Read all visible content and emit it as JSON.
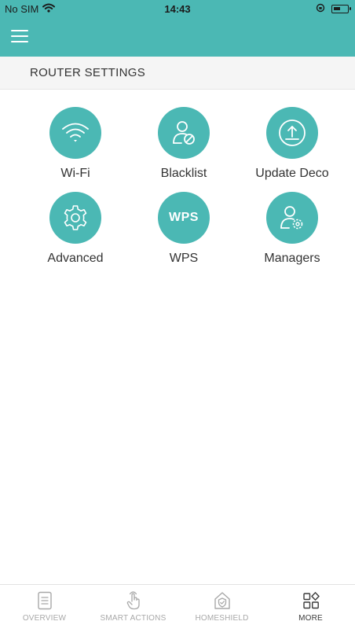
{
  "status_bar": {
    "carrier": "No SIM",
    "time": "14:43"
  },
  "header": {
    "menu_icon": "hamburger-menu-icon"
  },
  "section": {
    "title": "ROUTER SETTINGS"
  },
  "tiles": [
    {
      "label": "Wi-Fi",
      "icon": "wifi-icon"
    },
    {
      "label": "Blacklist",
      "icon": "user-block-icon"
    },
    {
      "label": "Update Deco",
      "icon": "upload-icon"
    },
    {
      "label": "Advanced",
      "icon": "gear-icon"
    },
    {
      "label": "WPS",
      "icon": "wps-icon",
      "icon_text": "WPS"
    },
    {
      "label": "Managers",
      "icon": "user-gear-icon"
    }
  ],
  "tabbar": {
    "items": [
      {
        "label": "OVERVIEW",
        "icon": "document-icon",
        "active": false
      },
      {
        "label": "SMART ACTIONS",
        "icon": "hand-tap-icon",
        "active": false
      },
      {
        "label": "HOMESHIELD",
        "icon": "home-shield-icon",
        "active": false
      },
      {
        "label": "MORE",
        "icon": "grid-more-icon",
        "active": true
      }
    ]
  },
  "colors": {
    "accent": "#4bb8b4",
    "tab_inactive": "#a8a8a8",
    "tab_active": "#3a3a3a"
  }
}
